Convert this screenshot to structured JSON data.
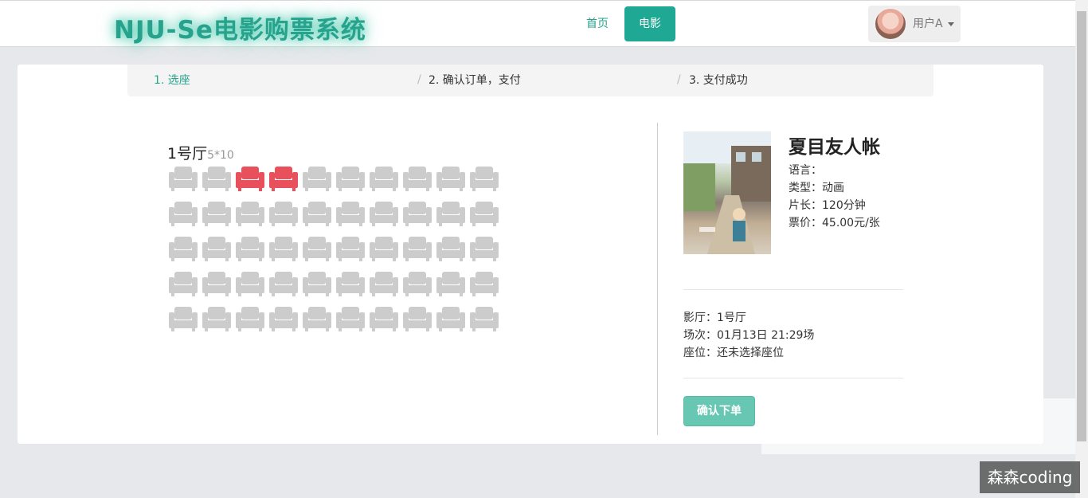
{
  "header": {
    "logo_text": "NJU-Se电影购票系统",
    "nav": {
      "home": "首页",
      "movie": "电影"
    },
    "user_name": "用户A"
  },
  "steps": [
    {
      "label": "1. 选座",
      "active": true
    },
    {
      "label": "2. 确认订单，支付",
      "active": false
    },
    {
      "label": "3. 支付成功",
      "active": false
    }
  ],
  "step_separator": "/",
  "hall": {
    "name": "1号厅",
    "size": "5*10",
    "rows": 5,
    "cols": 10,
    "highlighted_seats": [
      [
        0,
        2
      ],
      [
        0,
        3
      ]
    ]
  },
  "movie": {
    "title": "夏目友人帐",
    "language": "语言：",
    "genre": "类型：动画",
    "duration": "片长：120分钟",
    "price": "票价：45.00元/张"
  },
  "order": {
    "hall": "影厅：1号厅",
    "showtime": "场次：01月13日 21:29场",
    "seats": "座位：还未选择座位"
  },
  "confirm_button": "确认下单",
  "watermark": "森森coding",
  "colors": {
    "accent": "#1fa893",
    "seat_available": "#cccccc",
    "seat_highlight": "#e8505b",
    "button": "#67c7b3"
  }
}
